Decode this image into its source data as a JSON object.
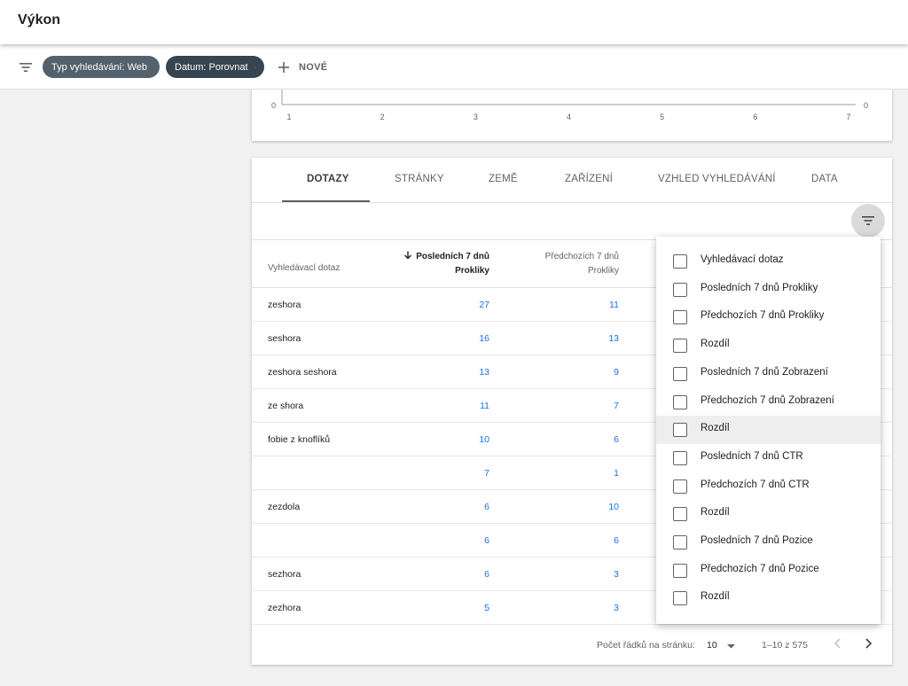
{
  "header": {
    "title": "Výkon"
  },
  "filters": {
    "chips": [
      {
        "label": "Typ vyhledávání: Web"
      },
      {
        "label": "Datum: Porovnat"
      }
    ],
    "new_label": "NOVÉ"
  },
  "chart_data": {
    "type": "line",
    "x_ticks": [
      "1",
      "2",
      "3",
      "4",
      "5",
      "6",
      "7"
    ],
    "y_left_min_label": "0",
    "y_right_min_label": "0"
  },
  "tabs": [
    {
      "label": "DOTAZY",
      "active": true
    },
    {
      "label": "STRÁNKY",
      "active": false
    },
    {
      "label": "ZEMĚ",
      "active": false
    },
    {
      "label": "ZAŘÍZENÍ",
      "active": false
    },
    {
      "label": "VZHLED VYHLEDÁVÁNÍ",
      "active": false
    },
    {
      "label": "DATA",
      "active": false
    }
  ],
  "table": {
    "headers": {
      "query": "Vyhledávací dotaz",
      "col1_line1": "Posledních 7 dnů",
      "col1_line2": "Prokliky",
      "col2_line1": "Předchozích 7 dnů",
      "col2_line2": "Prokliky"
    },
    "rows": [
      {
        "query": "zeshora",
        "last7": "27",
        "prev7": "11"
      },
      {
        "query": "seshora",
        "last7": "16",
        "prev7": "13"
      },
      {
        "query": "zeshora seshora",
        "last7": "13",
        "prev7": "9"
      },
      {
        "query": "ze shora",
        "last7": "11",
        "prev7": "7"
      },
      {
        "query": "fobie z knoflíků",
        "last7": "10",
        "prev7": "6"
      },
      {
        "query": "",
        "last7": "7",
        "prev7": "1"
      },
      {
        "query": "zezdola",
        "last7": "6",
        "prev7": "10"
      },
      {
        "query": "",
        "last7": "6",
        "prev7": "6"
      },
      {
        "query": "sezhora",
        "last7": "6",
        "prev7": "3"
      },
      {
        "query": "zezhora",
        "last7": "5",
        "prev7": "3"
      }
    ]
  },
  "pagination": {
    "rows_per_page_label": "Počet řádků na stránku:",
    "rows_per_page": "10",
    "range": "1–10 z 575"
  },
  "column_menu": {
    "items": [
      {
        "label": "Vyhledávací dotaz",
        "checked": false
      },
      {
        "label": "Posledních 7 dnů Prokliky",
        "checked": false
      },
      {
        "label": "Předchozích 7 dnů Prokliky",
        "checked": false
      },
      {
        "label": "Rozdíl",
        "checked": false
      },
      {
        "label": "Posledních 7 dnů Zobrazení",
        "checked": false
      },
      {
        "label": "Předchozích 7 dnů Zobrazení",
        "checked": false
      },
      {
        "label": "Rozdíl",
        "checked": false,
        "hovered": true
      },
      {
        "label": "Posledních 7 dnů CTR",
        "checked": false
      },
      {
        "label": "Předchozích 7 dnů CTR",
        "checked": false
      },
      {
        "label": "Rozdíl",
        "checked": false
      },
      {
        "label": "Posledních 7 dnů Pozice",
        "checked": false
      },
      {
        "label": "Předchozích 7 dnů Pozice",
        "checked": false
      },
      {
        "label": "Rozdíl",
        "checked": false
      }
    ]
  }
}
